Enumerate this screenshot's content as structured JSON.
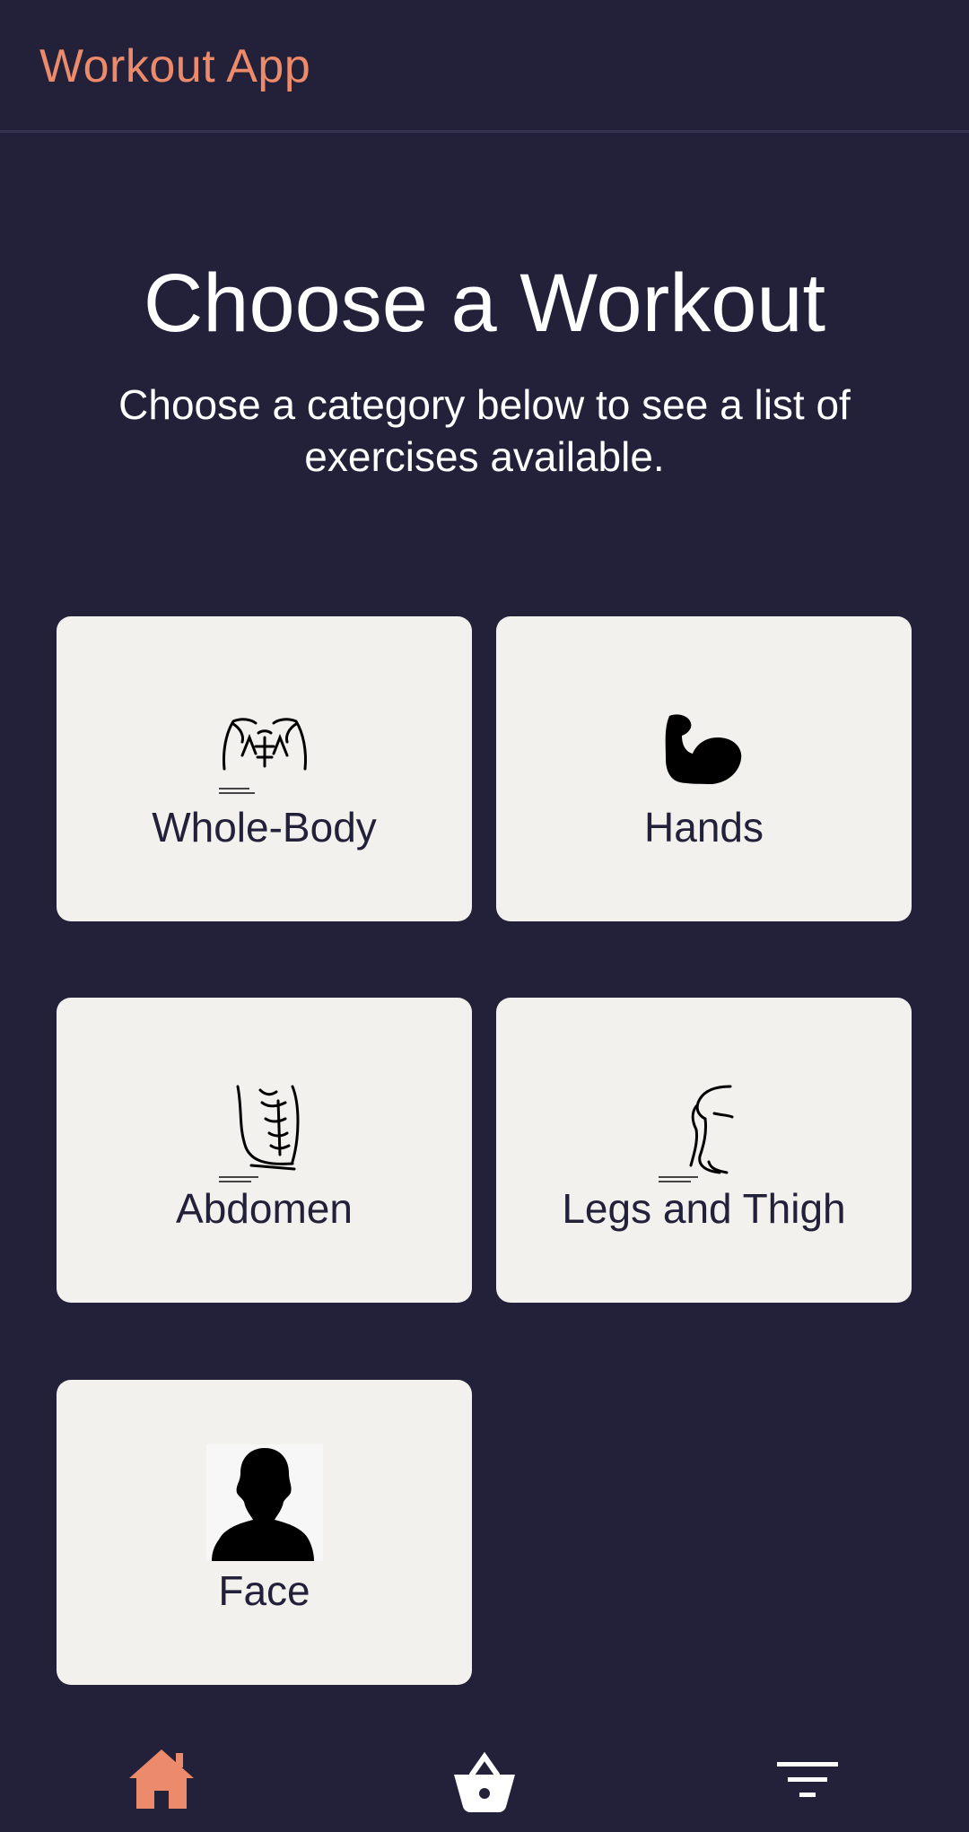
{
  "appbar": {
    "title": "Workout App"
  },
  "main": {
    "heading": "Choose a Workout",
    "subheading": "Choose a category below to see a list of exercises available."
  },
  "categories": [
    {
      "label": "Whole-Body",
      "icon": "torso-icon"
    },
    {
      "label": "Hands",
      "icon": "flexed-arm-icon"
    },
    {
      "label": "Abdomen",
      "icon": "abdomen-icon"
    },
    {
      "label": "Legs and Thigh",
      "icon": "leg-icon"
    },
    {
      "label": "Face",
      "icon": "person-silhouette-icon"
    }
  ],
  "bottom_nav": {
    "items": [
      {
        "icon": "home-icon"
      },
      {
        "icon": "basket-icon"
      },
      {
        "icon": "filter-icon"
      }
    ]
  },
  "colors": {
    "background": "#23213a",
    "accent": "#ec8a6c",
    "card": "#f2f1ee",
    "text_on_card": "#23213a"
  }
}
